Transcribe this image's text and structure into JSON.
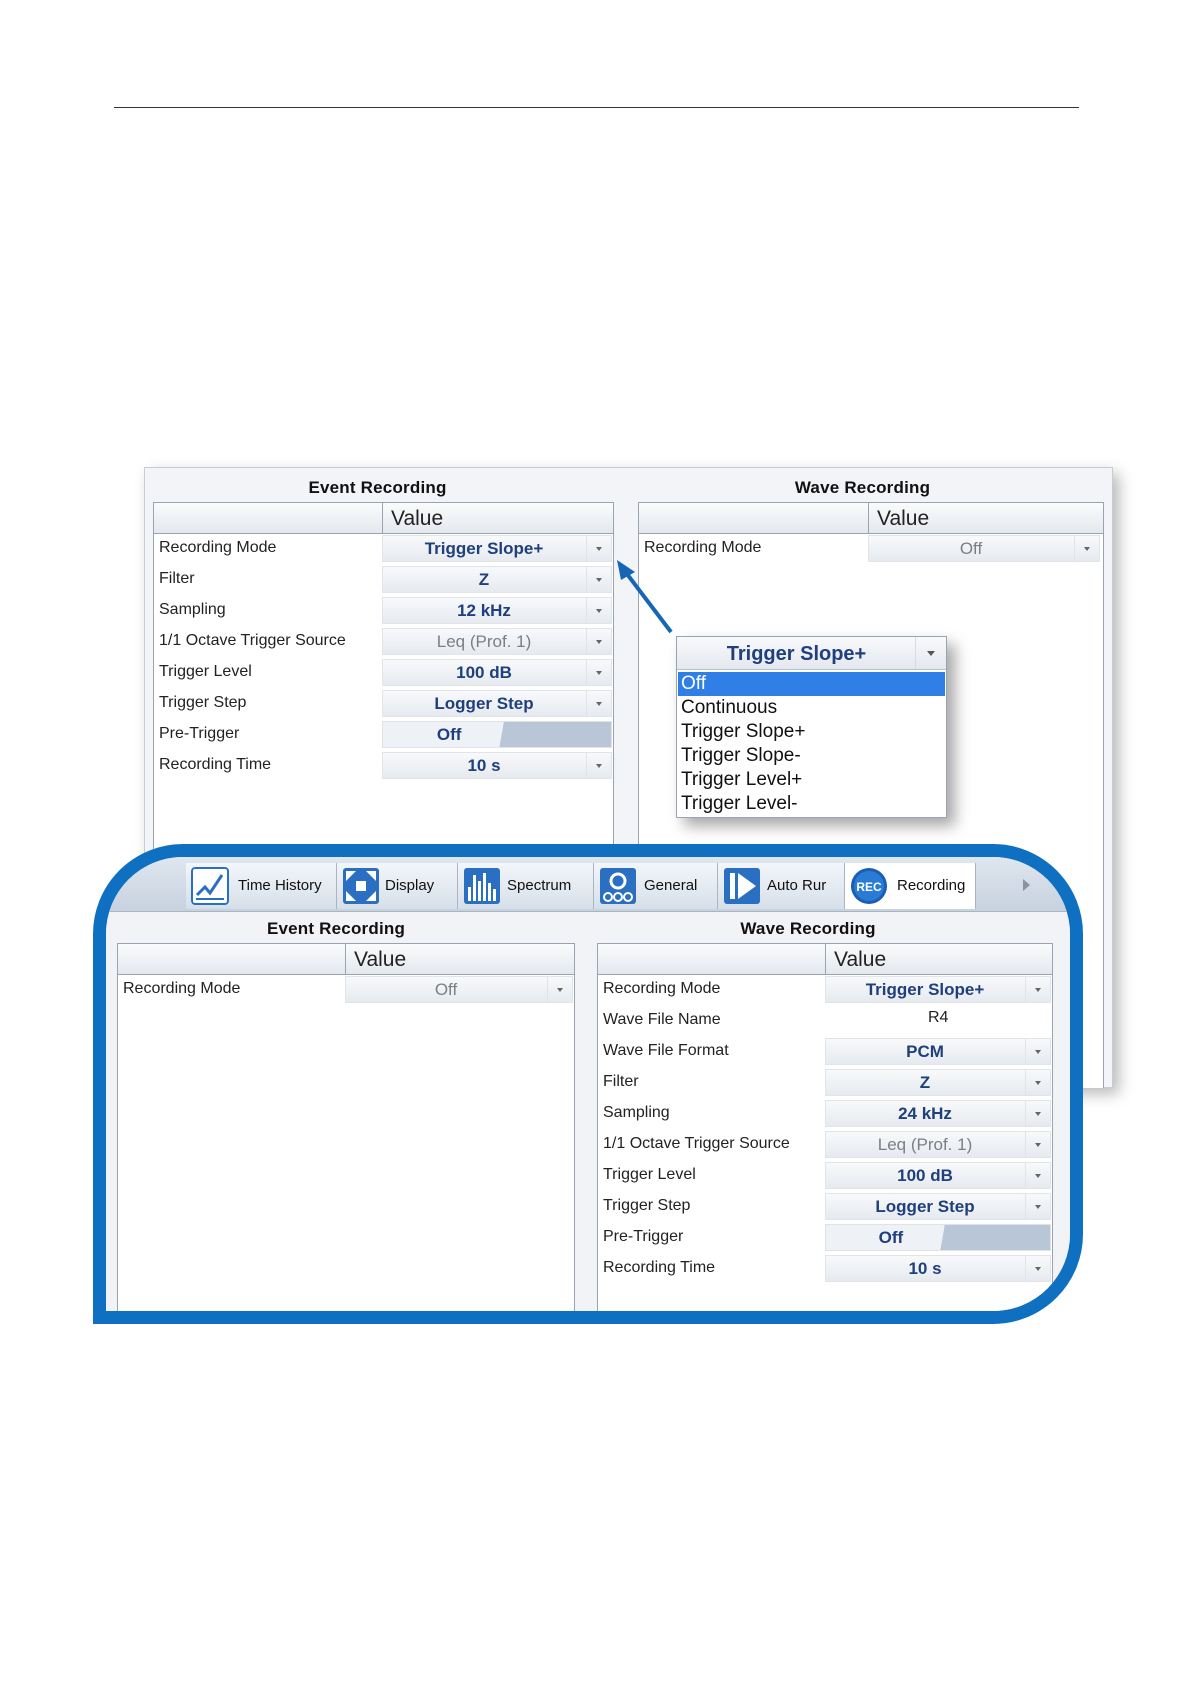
{
  "back": {
    "event": {
      "title": "Event Recording",
      "value_header": "Value",
      "rows": [
        {
          "label": "Recording Mode",
          "value": "Trigger Slope+"
        },
        {
          "label": "Filter",
          "value": "Z"
        },
        {
          "label": "Sampling",
          "value": "12 kHz"
        },
        {
          "label": "1/1 Octave Trigger Source",
          "value": "Leq (Prof. 1)"
        },
        {
          "label": "Trigger Level",
          "value": "100 dB"
        },
        {
          "label": "Trigger Step",
          "value": "Logger Step"
        },
        {
          "label": "Pre-Trigger",
          "value": "Off"
        },
        {
          "label": "Recording Time",
          "value": "10 s"
        }
      ]
    },
    "wave": {
      "title": "Wave Recording",
      "value_header": "Value",
      "rows": [
        {
          "label": "Recording Mode",
          "value": "Off"
        }
      ]
    },
    "popup": {
      "selected": "Trigger Slope+",
      "options": [
        "Off",
        "Continuous",
        "Trigger Slope+",
        "Trigger Slope-",
        "Trigger Level+",
        "Trigger Level-"
      ]
    }
  },
  "front": {
    "tabs": [
      {
        "label": "Time History",
        "icon": "time-history-icon"
      },
      {
        "label": "Display",
        "icon": "display-icon"
      },
      {
        "label": "Spectrum",
        "icon": "spectrum-icon"
      },
      {
        "label": "General",
        "icon": "general-icon"
      },
      {
        "label": "Auto Rur",
        "icon": "auto-run-icon"
      },
      {
        "label": "Recording",
        "icon": "rec-icon",
        "icon_text": "REC"
      }
    ],
    "event": {
      "title": "Event Recording",
      "value_header": "Value",
      "rows": [
        {
          "label": "Recording Mode",
          "value": "Off"
        }
      ]
    },
    "wave": {
      "title": "Wave Recording",
      "value_header": "Value",
      "rows": [
        {
          "label": "Recording Mode",
          "value": "Trigger Slope+"
        },
        {
          "label": "Wave File Name",
          "value": "R4"
        },
        {
          "label": "Wave File Format",
          "value": "PCM"
        },
        {
          "label": "Filter",
          "value": "Z"
        },
        {
          "label": "Sampling",
          "value": "24 kHz"
        },
        {
          "label": "1/1 Octave Trigger Source",
          "value": "Leq (Prof. 1)"
        },
        {
          "label": "Trigger Level",
          "value": "100 dB"
        },
        {
          "label": "Trigger Step",
          "value": "Logger Step"
        },
        {
          "label": "Pre-Trigger",
          "value": "Off"
        },
        {
          "label": "Recording Time",
          "value": "10 s"
        }
      ]
    }
  },
  "colors": {
    "frame": "#0f6fc1",
    "value_text": "#1f3f7d",
    "selection": "#2f7fe6"
  }
}
